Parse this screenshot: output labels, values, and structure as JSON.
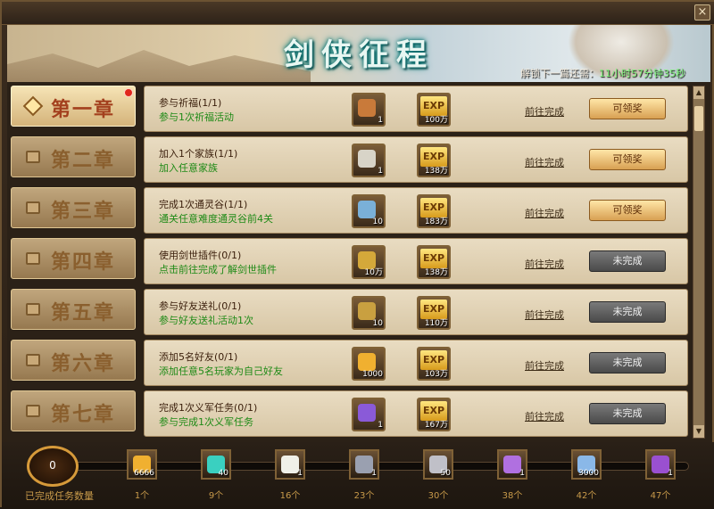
{
  "window": {
    "title": "剑侠征程",
    "unlock_label": "解锁下一篇还需：",
    "unlock_time": "11小时57分钟35秒",
    "close_glyph": "×"
  },
  "chapters": [
    {
      "label": "第一章",
      "state": "active",
      "has_dot": true
    },
    {
      "label": "第二章",
      "state": "locked"
    },
    {
      "label": "第三章",
      "state": "locked"
    },
    {
      "label": "第四章",
      "state": "locked"
    },
    {
      "label": "第五章",
      "state": "locked"
    },
    {
      "label": "第六章",
      "state": "locked"
    },
    {
      "label": "第七章",
      "state": "locked"
    }
  ],
  "tasks": [
    {
      "name": "参与祈福(1/1)",
      "desc": "参与1次祈福活动",
      "item_icon": "charm-icon",
      "item_count": "1",
      "exp": "100万",
      "go": "前往完成",
      "button": "可领奖",
      "claimable": true
    },
    {
      "name": "加入1个家族(1/1)",
      "desc": "加入任意家族",
      "item_icon": "ingot-icon",
      "item_count": "1",
      "exp": "138万",
      "go": "前往完成",
      "button": "可领奖",
      "claimable": true
    },
    {
      "name": "完成1次通灵谷(1/1)",
      "desc": "通关任意难度通灵谷前4关",
      "item_icon": "chest-icon",
      "item_count": "10",
      "exp": "183万",
      "go": "前往完成",
      "button": "可领奖",
      "claimable": true
    },
    {
      "name": "使用剑世插件(0/1)",
      "desc": "点击前往完成了解剑世插件",
      "item_icon": "coin-icon",
      "item_count": "10万",
      "exp": "138万",
      "go": "前往完成",
      "button": "未完成",
      "claimable": false
    },
    {
      "name": "参与好友送礼(0/1)",
      "desc": "参与好友送礼活动1次",
      "item_icon": "medal-icon",
      "item_count": "10",
      "exp": "110万",
      "go": "前往完成",
      "button": "未完成",
      "claimable": false
    },
    {
      "name": "添加5名好友(0/1)",
      "desc": "添加任意5名玩家为自己好友",
      "item_icon": "feather-icon",
      "item_count": "1000",
      "exp": "103万",
      "go": "前往完成",
      "button": "未完成",
      "claimable": false
    },
    {
      "name": "完成1次义军任务(0/1)",
      "desc": "参与完成1次义军任务",
      "item_icon": "crystal-icon",
      "item_count": "1",
      "exp": "167万",
      "go": "前往完成",
      "button": "未完成",
      "claimable": false
    }
  ],
  "bottom": {
    "completed_count": "0",
    "completed_label": "已完成任务数量",
    "rewards": [
      {
        "icon": "feather-icon",
        "count": "6666",
        "label": "1个"
      },
      {
        "icon": "teal-gem-icon",
        "count": "40",
        "label": "9个"
      },
      {
        "icon": "pet-egg-icon",
        "count": "1",
        "label": "16个"
      },
      {
        "icon": "armor-icon",
        "count": "1",
        "label": "23个"
      },
      {
        "icon": "goblet-icon",
        "count": "50",
        "label": "30个"
      },
      {
        "icon": "purple-crystal-icon",
        "count": "1",
        "label": "38个"
      },
      {
        "icon": "blue-orb-icon",
        "count": "3000",
        "label": "42个"
      },
      {
        "icon": "purple-orb-icon",
        "count": "1",
        "label": "47个"
      }
    ]
  },
  "exp_label": "EXP"
}
